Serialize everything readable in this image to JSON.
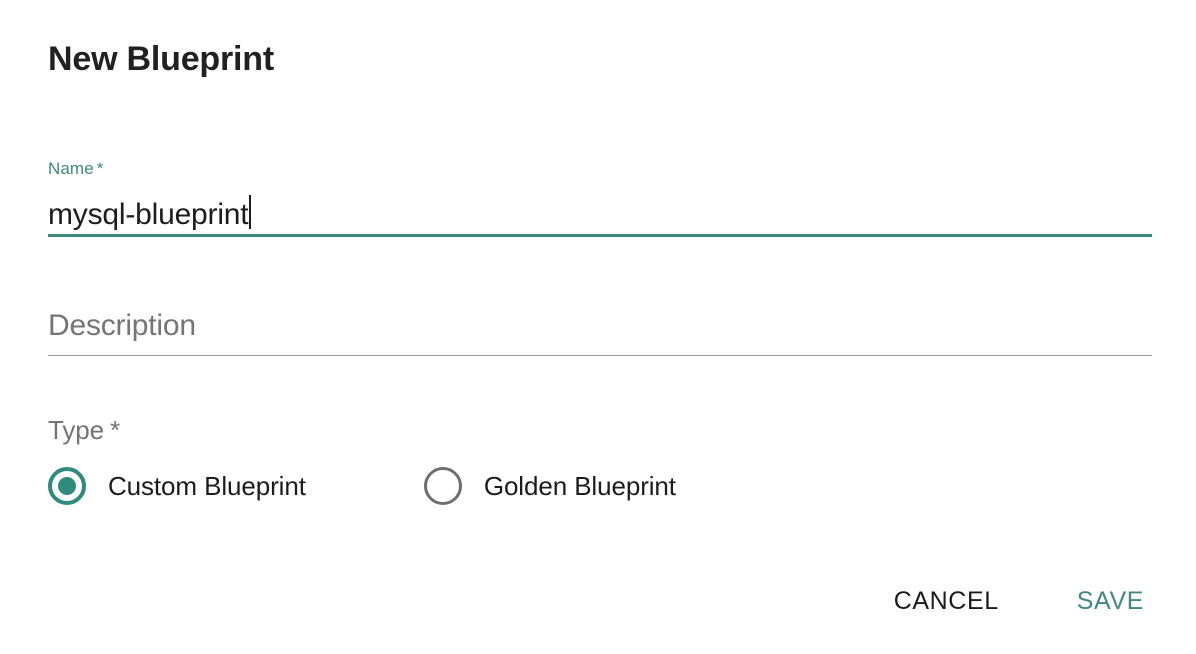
{
  "dialog": {
    "title": "New Blueprint"
  },
  "fields": {
    "name": {
      "label": "Name",
      "required_marker": "*",
      "value": "mysql-blueprint",
      "state": "focused",
      "accent_color": "#3d8b80"
    },
    "description": {
      "label": "",
      "placeholder": "Description",
      "value": "",
      "state": "empty",
      "line_color": "#9a9a9a"
    },
    "type": {
      "label": "Type",
      "required_marker": "*",
      "selected": "Custom Blueprint",
      "options": [
        {
          "label": "Custom Blueprint",
          "checked": true
        },
        {
          "label": "Golden Blueprint",
          "checked": false
        }
      ]
    }
  },
  "actions": {
    "cancel_label": "CANCEL",
    "save_label": "SAVE"
  },
  "colors": {
    "accent_teal": "#3d8b80",
    "radio_selected": "#2e8b7d",
    "radio_unselected": "#6e6e6e",
    "text_primary": "#1c1c1c",
    "text_secondary": "#757575",
    "save_teal": "#43897f",
    "background": "#ffffff"
  }
}
